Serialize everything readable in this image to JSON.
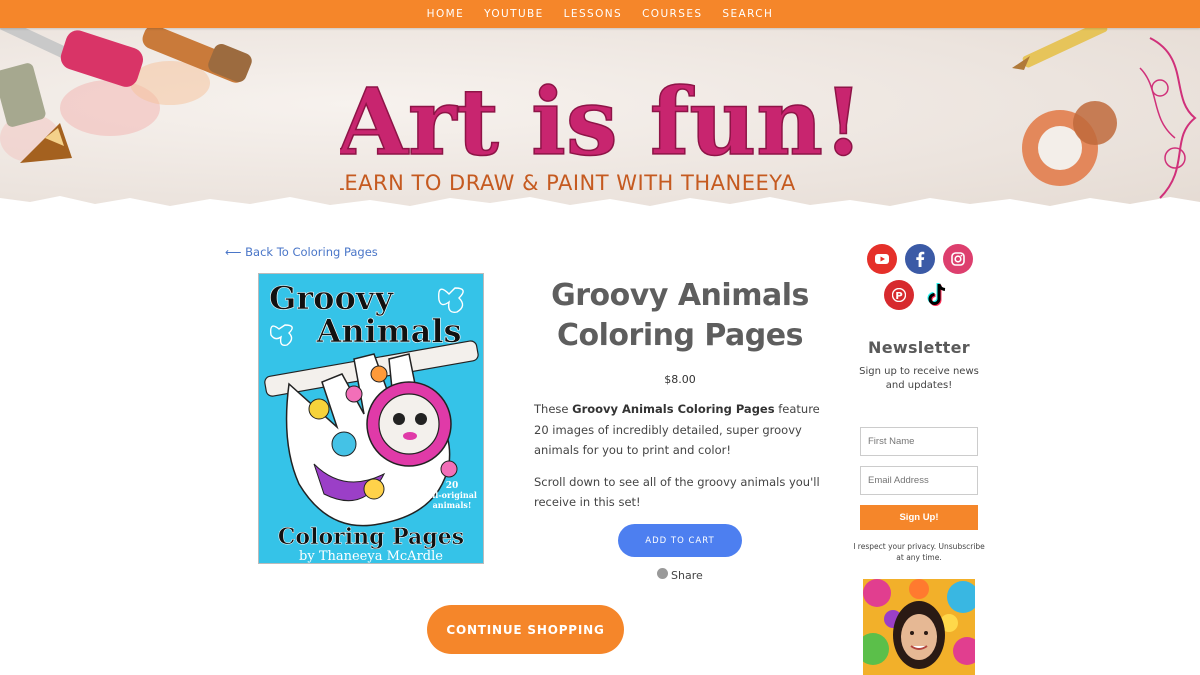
{
  "nav": {
    "items": [
      {
        "label": "HOME"
      },
      {
        "label": "YOUTUBE"
      },
      {
        "label": "LESSONS"
      },
      {
        "label": "COURSES"
      },
      {
        "label": "SEARCH"
      }
    ]
  },
  "banner": {
    "title": "Art is fun!",
    "tagline": "LEARN TO DRAW & PAINT WITH THANEEYA"
  },
  "back_link": "⟵ Back To Coloring Pages",
  "product": {
    "cover": {
      "title_line1": "Groovy",
      "title_line2": "Animals",
      "bottom_title": "Coloring Pages",
      "author": "by Thaneeya McArdle",
      "badge_line1": "20",
      "badge_line2": "all-original",
      "badge_line3": "animals!"
    },
    "title": "Groovy Animals Coloring Pages",
    "price": "$8.00",
    "desc1_pre": "These ",
    "desc1_bold": "Groovy Animals Coloring Pages",
    "desc1_post": " feature 20 images of incredibly detailed, super groovy animals for you to print and color!",
    "desc2": "Scroll down to see all of the groovy animals you'll receive in this set!",
    "add_to_cart": "ADD TO CART",
    "share": "Share",
    "continue": "CONTINUE SHOPPING"
  },
  "sidebar": {
    "social": [
      {
        "icon": "youtube-icon",
        "color": "#e5302a"
      },
      {
        "icon": "facebook-icon",
        "color": "#3b5aa6"
      },
      {
        "icon": "instagram-icon",
        "color": "#dd3f6e"
      },
      {
        "icon": "pinterest-icon",
        "color": "#d72a2e"
      },
      {
        "icon": "tiktok-icon",
        "color": "#ffffff"
      }
    ],
    "newsletter_title": "Newsletter",
    "newsletter_sub": "Sign up to receive news and updates!",
    "first_name_placeholder": "First Name",
    "email_placeholder": "Email Address",
    "signup": "Sign Up!",
    "privacy": "I respect your privacy. Unsubscribe at any time."
  },
  "colors": {
    "accent": "#f5862a",
    "button_blue": "#4d7ff0",
    "link": "#4a76c8",
    "cover_bg": "#35c3e8"
  }
}
